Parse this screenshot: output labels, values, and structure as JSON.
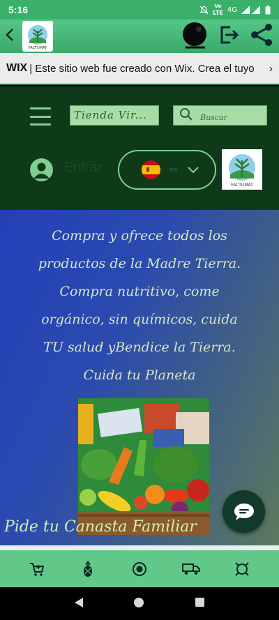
{
  "status_bar": {
    "time": "5:16",
    "network_label": "LTE",
    "signal_label": "4G",
    "icons": [
      "mute-icon",
      "volte-icon",
      "signal-icon",
      "battery-icon"
    ]
  },
  "app_bar": {
    "icons": [
      "back-icon",
      "logo",
      "bell-icon",
      "exit-icon",
      "share-icon"
    ]
  },
  "wix_banner": {
    "brand": "WIX",
    "text": " | Este sitio web fue creado con Wix. Crea el tuyo",
    "chevron": "›"
  },
  "site_header": {
    "store_label": "Tienda Vir...",
    "search_placeholder": "Buscar",
    "login_label": "Entrar",
    "language_code": "es",
    "logo_caption": "FACTUMAT"
  },
  "hero": {
    "lines": [
      "Compra y ofrece todos los",
      "productos de la Madre Tierra.",
      "Compra nutritivo, come",
      "orgánico, sin químicos, cuida",
      "TU salud yBendice la Tierra.",
      "Cuida tu Planeta"
    ],
    "cta": "Pide tu Canasta Familiar"
  },
  "bottom_nav": {
    "icons": [
      "cart-icon",
      "pineapple-icon",
      "target-icon",
      "truck-icon",
      "globe-icon"
    ]
  },
  "colors": {
    "status": "#3ab06a",
    "header_dark": "#0f3a1a",
    "accent": "#7fcf94",
    "bottom_bar": "#61c889"
  }
}
